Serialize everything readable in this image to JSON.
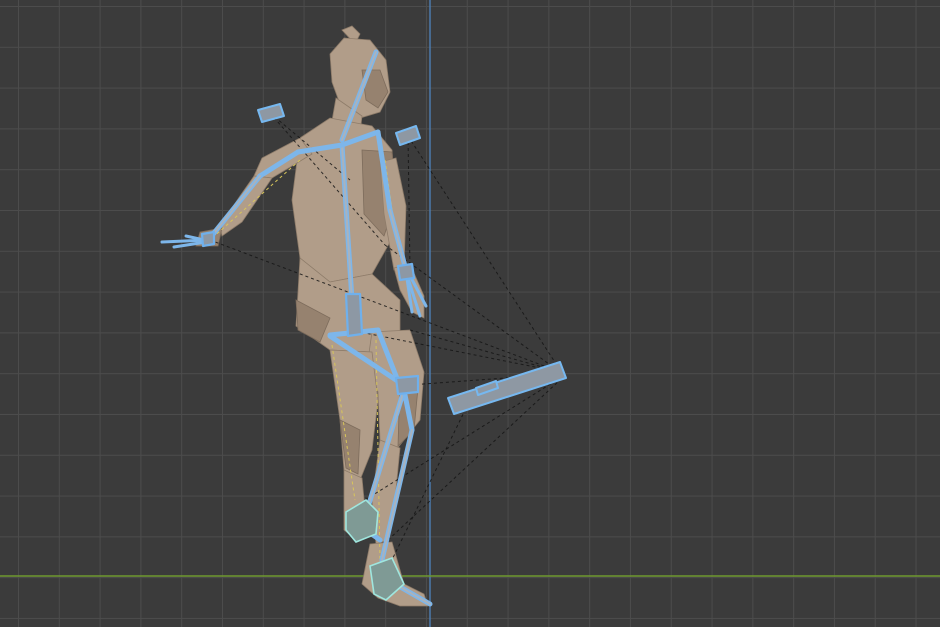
{
  "viewport": {
    "view": "3D viewport",
    "colors": {
      "background": "#3b3b3b",
      "grid": "#4c4c4c",
      "x_axis": "#6f9a2f",
      "z_axis": "#4d7fb5",
      "bone_outline": "#6fb0ec",
      "mesh": "#b19d89"
    },
    "objects": [
      "character-mesh",
      "armature",
      "hand-ik-controls",
      "foot-ik-controls",
      "root-control"
    ]
  }
}
